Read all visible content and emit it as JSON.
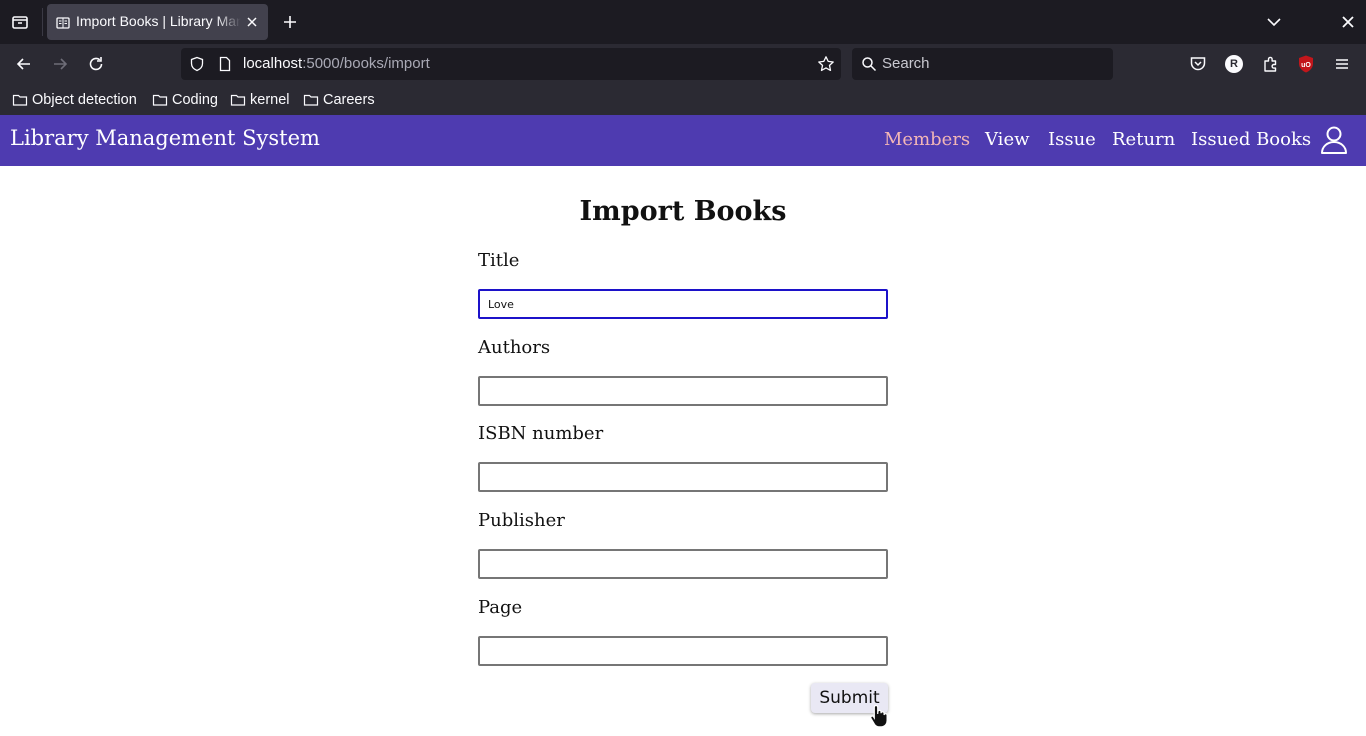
{
  "browser": {
    "tab": {
      "title": "Import Books | Library Management System",
      "favicon": "book-favicon-icon"
    },
    "url": {
      "host": "localhost",
      "rest": ":5000/books/import"
    },
    "search_placeholder": "Search",
    "profile_initial": "R",
    "ublock_label": "uO",
    "bookmarks": [
      "Object detection",
      "Coding",
      "kernel",
      "Careers"
    ],
    "icons": [
      "tab-list-icon",
      "close-icon",
      "plus-icon",
      "chevron-down-icon",
      "back-arrow-icon",
      "forward-arrow-icon",
      "reload-icon",
      "shield-icon",
      "page-icon",
      "star-icon",
      "search-icon",
      "pocket-icon",
      "extensions-icon",
      "ublock-icon",
      "hamburger-menu-icon",
      "folder-icon"
    ]
  },
  "app": {
    "brand": "Library Management System",
    "nav": [
      "Members",
      "View",
      "Issue",
      "Return",
      "Issued Books"
    ],
    "active_nav": "Members",
    "header_color": "#4e3bb0",
    "active_color": "#f2b6b6"
  },
  "form": {
    "title": "Import Books",
    "fields": [
      {
        "label": "Title",
        "value": "Love"
      },
      {
        "label": "Authors",
        "value": ""
      },
      {
        "label": "ISBN number",
        "value": ""
      },
      {
        "label": "Publisher",
        "value": ""
      },
      {
        "label": "Page",
        "value": ""
      }
    ],
    "submit_label": "Submit",
    "focus_color": "#1c12c9"
  }
}
